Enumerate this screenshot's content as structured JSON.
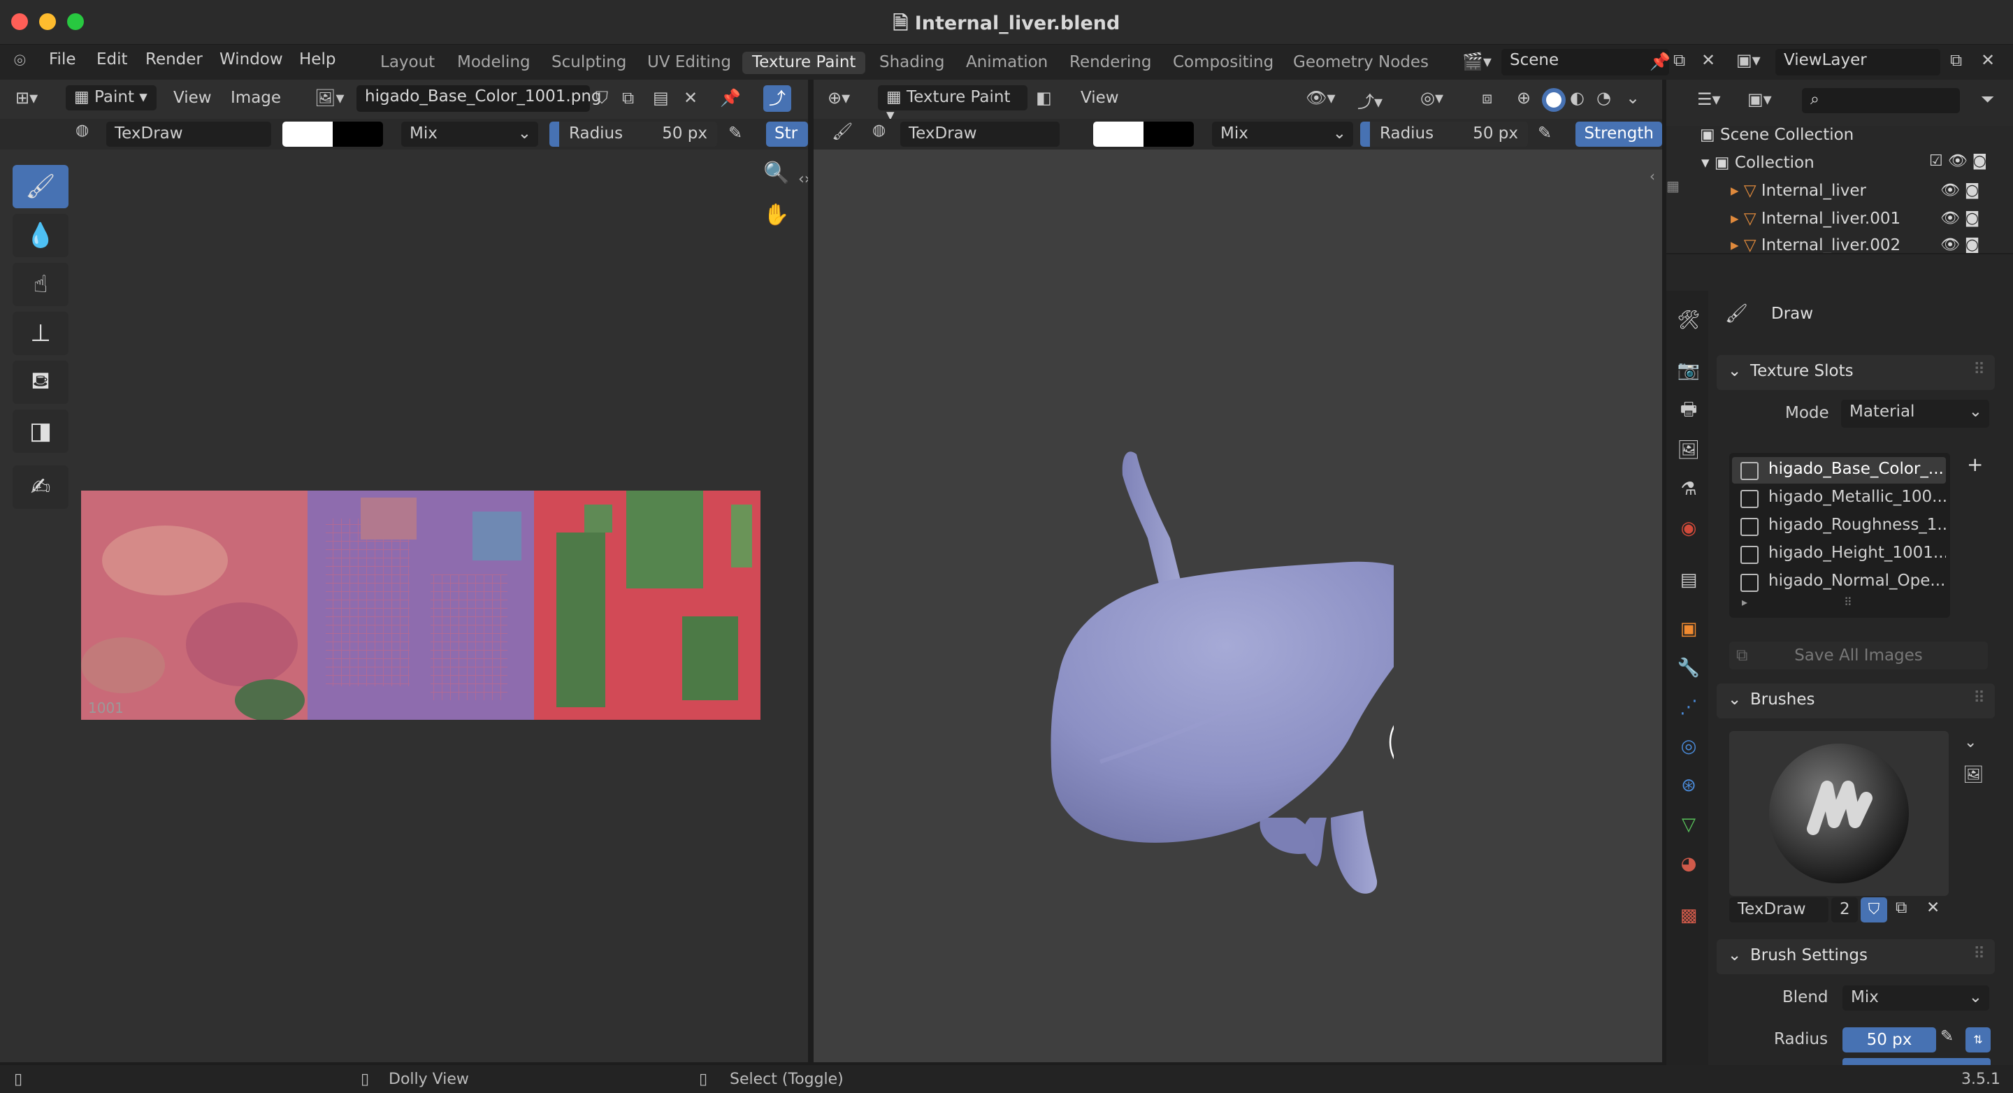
{
  "window": {
    "title": "Internal_liver.blend"
  },
  "menu": [
    "File",
    "Edit",
    "Render",
    "Window",
    "Help"
  ],
  "workspaces": [
    "Layout",
    "Modeling",
    "Sculpting",
    "UV Editing",
    "Texture Paint",
    "Shading",
    "Animation",
    "Rendering",
    "Compositing",
    "Geometry Nodes"
  ],
  "active_workspace": "Texture Paint",
  "scene": {
    "name": "Scene"
  },
  "view_layer": {
    "name": "ViewLayer"
  },
  "image_editor": {
    "mode": "Paint",
    "view_menu": "View",
    "image_menu": "Image",
    "image_name": "higado_Base_Color_1001.png",
    "brush": "TexDraw",
    "blend": "Mix",
    "radius_label": "Radius",
    "radius_value": "50 px",
    "strength_label": "Str",
    "tile_label": "1001"
  },
  "viewport": {
    "mode": "Texture Paint",
    "view_menu": "View",
    "brush": "TexDraw",
    "blend": "Mix",
    "radius_label": "Radius",
    "radius_value": "50 px",
    "strength_label": "Strength"
  },
  "outliner": {
    "scene_collection": "Scene Collection",
    "collection": "Collection",
    "objects": [
      "Internal_liver",
      "Internal_liver.001",
      "Internal_liver.002"
    ]
  },
  "properties": {
    "tool_name": "Draw",
    "texture_slots": {
      "title": "Texture Slots",
      "mode_label": "Mode",
      "mode_value": "Material",
      "slots": [
        "higado_Base_Color_...",
        "higado_Metallic_100...",
        "higado_Roughness_1...",
        "higado_Height_1001...",
        "higado_Normal_Ope..."
      ],
      "save_button": "Save All Images"
    },
    "brushes": {
      "title": "Brushes",
      "brush_name": "TexDraw",
      "users": "2"
    },
    "brush_settings": {
      "title": "Brush Settings",
      "blend_label": "Blend",
      "blend_value": "Mix",
      "radius_label": "Radius",
      "radius_value": "50 px"
    }
  },
  "statusbar": {
    "left": "Dolly View",
    "middle": "Select (Toggle)",
    "version": "3.5.1"
  },
  "colors": {
    "accent": "#4772b3",
    "liver": "#8a8fc0",
    "bg": "#1d1d1d"
  }
}
